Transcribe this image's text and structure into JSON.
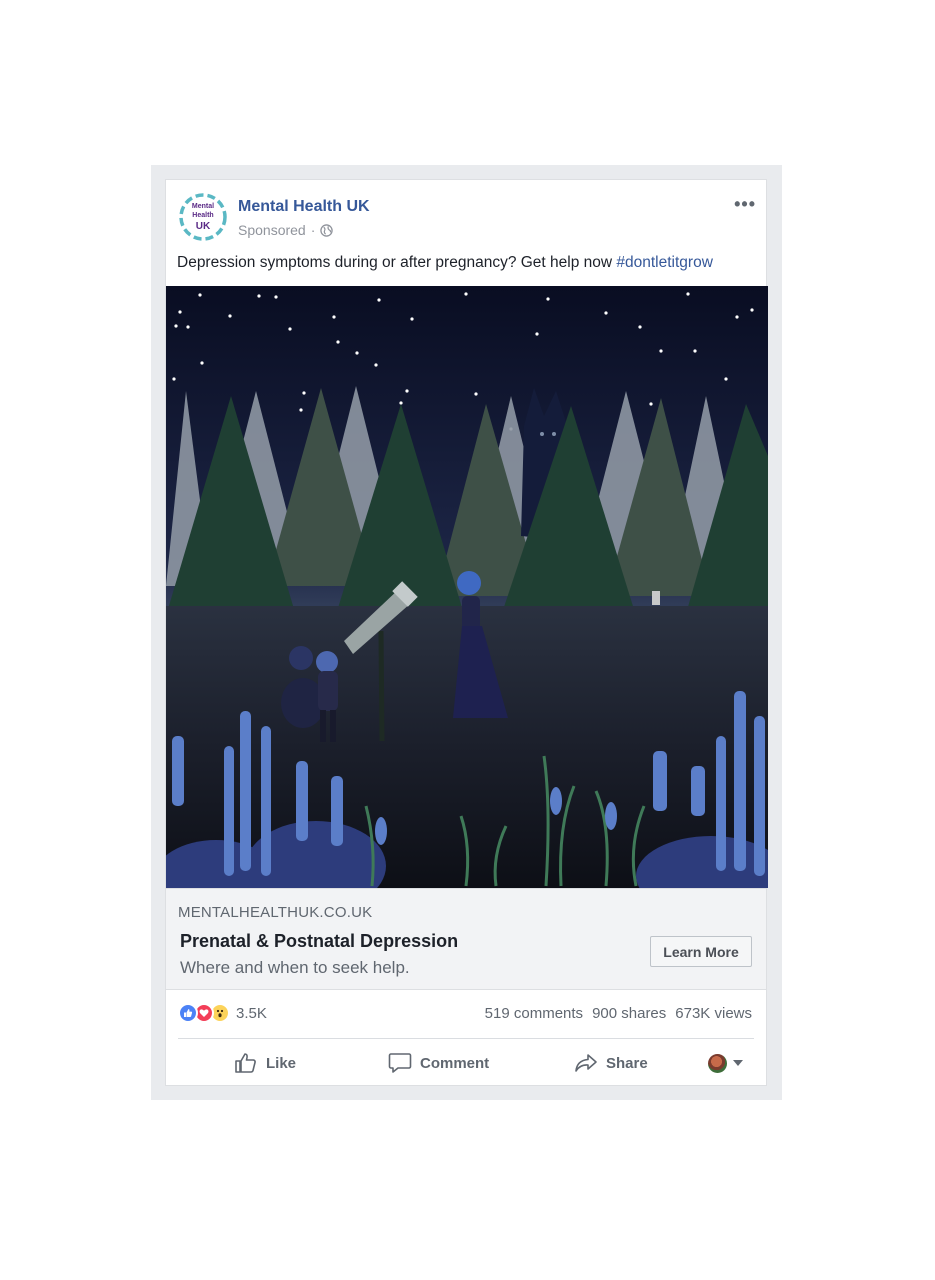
{
  "post": {
    "page_name": "Mental Health UK",
    "sponsored_label": "Sponsored",
    "avatar": {
      "line1": "Mental",
      "line2": "Health",
      "line3": "UK"
    },
    "text": "Depression symptoms during or after pregnancy? Get help now ",
    "hashtag": "#dontletitgrow",
    "more_label": "•••"
  },
  "link": {
    "domain": "MENTALHEALTHUK.CO.UK",
    "headline": "Prenatal & Postnatal Depression",
    "description": "Where and when to seek help.",
    "cta_label": "Learn More"
  },
  "engagement": {
    "reaction_icons": [
      "like-icon",
      "love-icon",
      "wow-icon"
    ],
    "reaction_count": "3.5K",
    "comments": "519 comments",
    "shares": "900 shares",
    "views": "673K views"
  },
  "actions": {
    "like": "Like",
    "comment": "Comment",
    "share": "Share"
  },
  "colors": {
    "link_blue": "#365899",
    "avatar_ring": "#5ab8c4",
    "like_blue": "#4c82f6",
    "love_red": "#f33e58",
    "wow_yellow": "#fcd35a"
  }
}
